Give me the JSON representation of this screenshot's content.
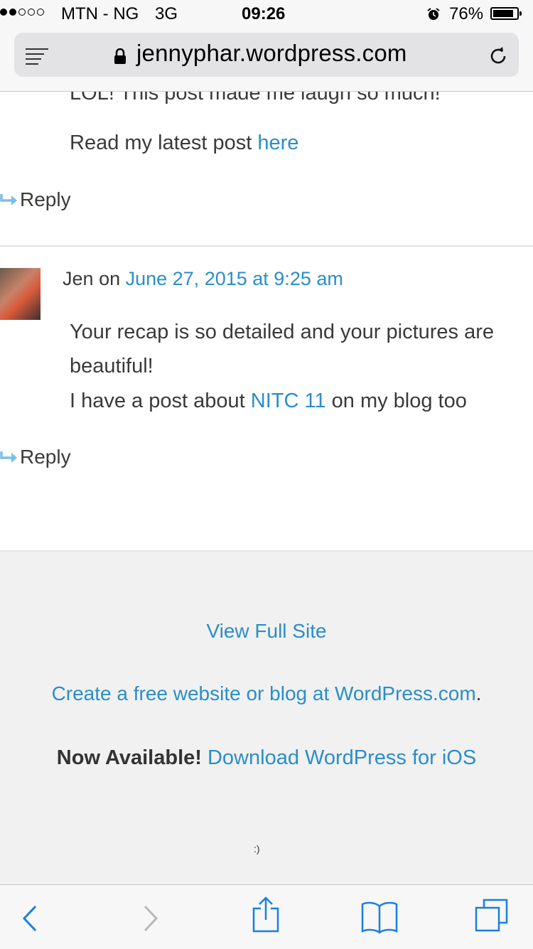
{
  "status_bar": {
    "signal_dots_filled": 2,
    "signal_dots_total": 5,
    "carrier": "MTN - NG",
    "network": "3G",
    "time": "09:26",
    "battery_percent": "76%",
    "battery_level": 0.76,
    "icons": [
      "signal-dots-icon",
      "alarm-icon",
      "battery-icon"
    ]
  },
  "address_bar": {
    "url": "jennyphar.wordpress.com",
    "icons": [
      "reader-icon",
      "lock-icon",
      "reload-icon"
    ]
  },
  "comments": [
    {
      "partial_text": "LOL! This post made me laugh so much!",
      "text_prefix": "Read my latest post ",
      "link": "here",
      "reply_label": "Reply"
    },
    {
      "author": "Jen",
      "on": "on",
      "date_link": "June 27, 2015 at 9:25 am",
      "line1": "Your recap is so detailed and your pictures are",
      "line2": "beautiful!",
      "line3_prefix": "I have a post about ",
      "line3_link": "NITC 11",
      "line3_suffix": " on my blog too",
      "reply_label": "Reply"
    }
  ],
  "footer": {
    "view_full_site": "View Full Site",
    "create_link": "Create a free website or blog at WordPress.com",
    "create_suffix": ".",
    "now_available": "Now Available!",
    "download_link": "Download WordPress for iOS",
    "smiley": ":)"
  },
  "colors": {
    "link": "#2a8ec8",
    "text": "#3a3a3a",
    "footer_bg": "#f1f1f1",
    "ios_blue": "#1a7fe0"
  },
  "toolbar": {
    "icons": [
      "back-icon",
      "forward-icon",
      "share-icon",
      "bookmarks-icon",
      "tabs-icon"
    ]
  }
}
